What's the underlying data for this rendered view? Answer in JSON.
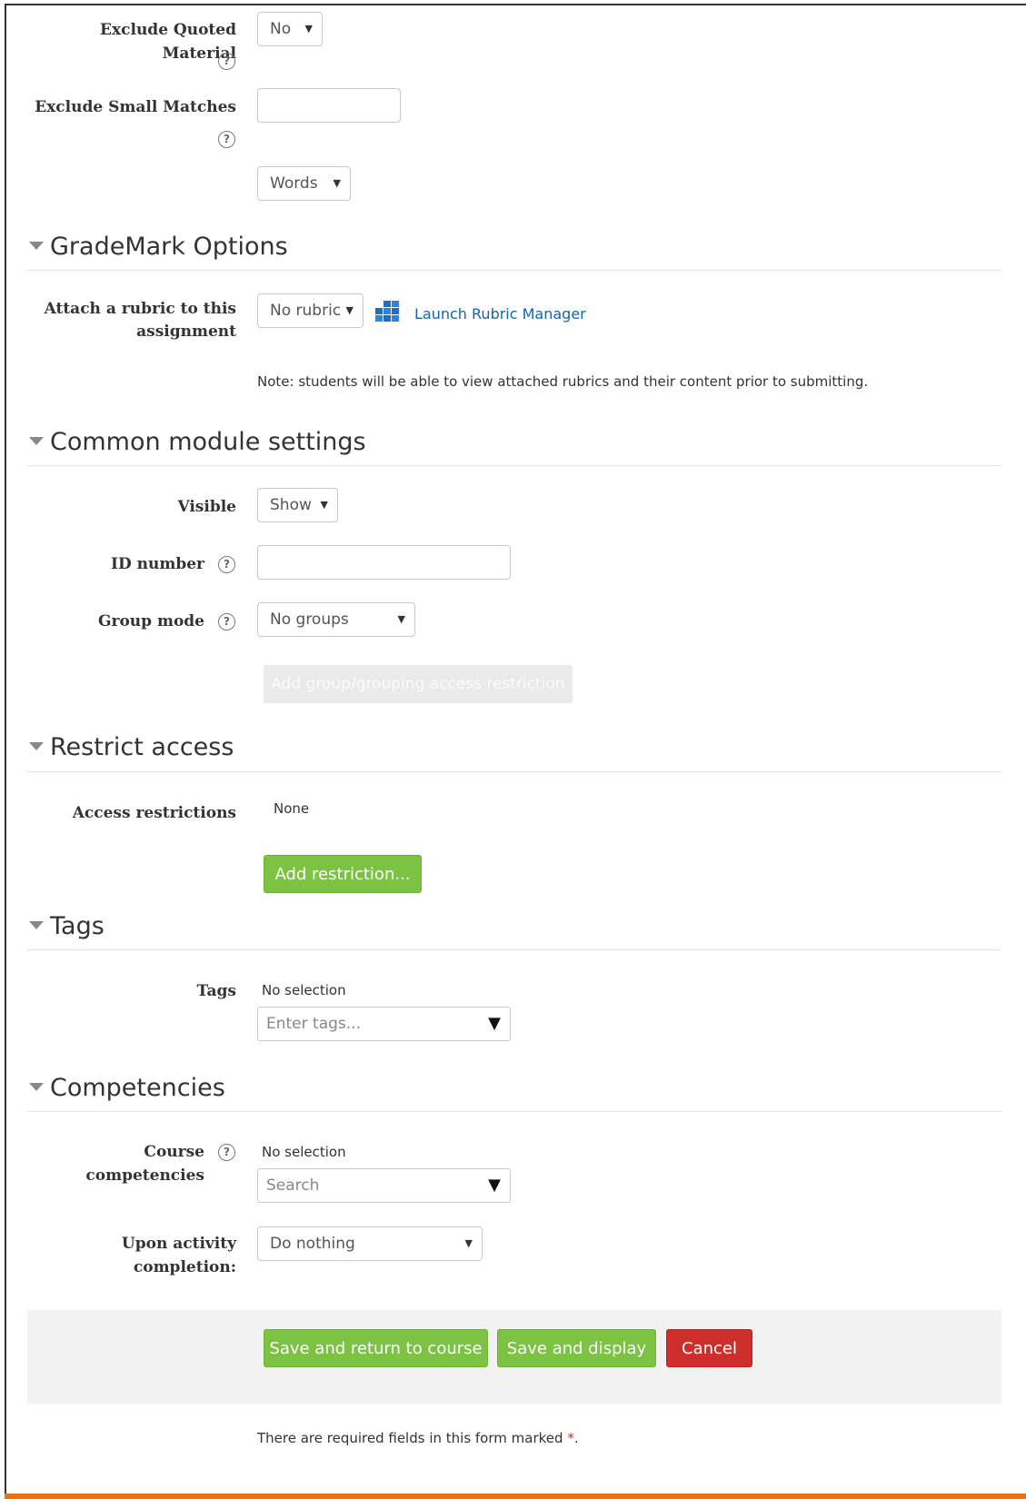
{
  "exclude_quoted": {
    "label": "Exclude Quoted Material",
    "value": "No"
  },
  "exclude_small": {
    "label": "Exclude Small Matches",
    "unit_value": "Words"
  },
  "help_glyph": "?",
  "grademark": {
    "title": "GradeMark Options",
    "rubric_label_line1": "Attach a rubric to this",
    "rubric_label_line2": "assignment",
    "rubric_value": "No rubric",
    "launch_link": "Launch Rubric Manager",
    "note": "Note: students will be able to view attached rubrics and their content prior to submitting."
  },
  "common": {
    "title": "Common module settings",
    "visible_label": "Visible",
    "visible_value": "Show",
    "idnumber_label": "ID number",
    "groupmode_label": "Group mode",
    "groupmode_value": "No groups",
    "add_group_restriction": "Add group/grouping access restriction"
  },
  "restrict": {
    "title": "Restrict access",
    "access_label": "Access restrictions",
    "access_value": "None",
    "add_restriction": "Add restriction..."
  },
  "tags": {
    "title": "Tags",
    "label": "Tags",
    "selection": "No selection",
    "placeholder": "Enter tags..."
  },
  "competencies": {
    "title": "Competencies",
    "course_label": "Course competencies",
    "selection": "No selection",
    "search_placeholder": "Search",
    "completion_label": "Upon activity completion:",
    "completion_value": "Do nothing"
  },
  "buttons": {
    "save_return": "Save and return to course",
    "save_display": "Save and display",
    "cancel": "Cancel"
  },
  "required_note": {
    "text": "There are required fields in this form marked",
    "marker": "*",
    "end": "."
  },
  "colors": {
    "green": "#7cc243",
    "red": "#ce2f2c",
    "link": "#1565a8",
    "accent_bar": "#e8721c"
  }
}
